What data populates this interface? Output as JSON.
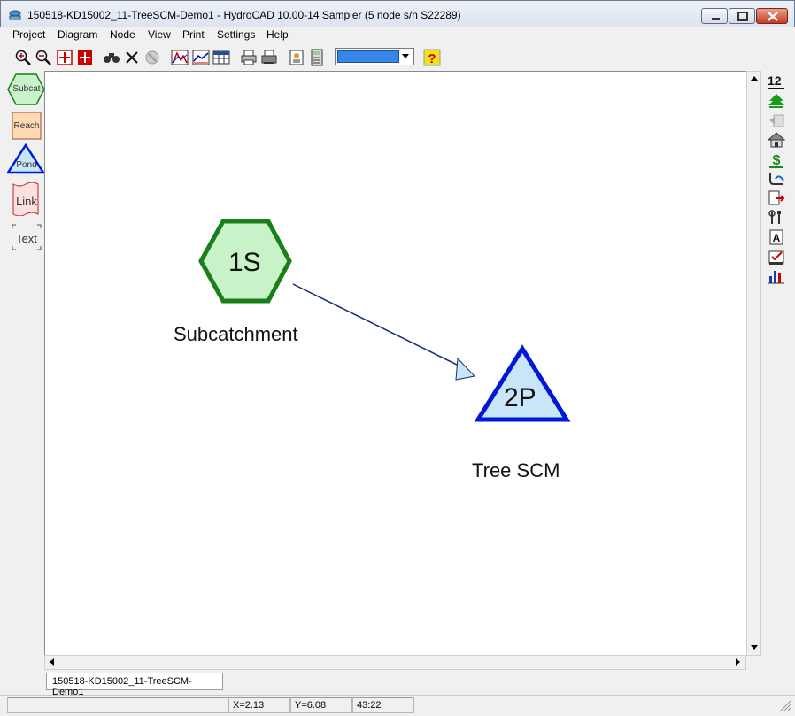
{
  "window": {
    "title": "150518-KD15002_11-TreeSCM-Demo1 - HydroCAD 10.00-14 Sampler (5 node s/n S22289)"
  },
  "menu": [
    "Project",
    "Diagram",
    "Node",
    "View",
    "Print",
    "Settings",
    "Help"
  ],
  "toolbar": {
    "icons": [
      "zoom-in-icon",
      "zoom-out-icon",
      "zoom-fit-icon",
      "zoom-all-icon",
      "find-binoculars-icon",
      "delete-icon",
      "disabled-tool-icon",
      "hydrograph-icon",
      "chart-icon",
      "table-icon",
      "print-icon",
      "print-preview-icon",
      "report-icon",
      "calculator-icon",
      "help-icon"
    ],
    "color_value": "#3a86e8"
  },
  "palette": {
    "subcat": "Subcat",
    "reach": "Reach",
    "pond": "Pond",
    "link": "Link",
    "text": "Text"
  },
  "diagram": {
    "nodes": [
      {
        "id": "1S",
        "label": "Subcatchment",
        "type": "subcatchment"
      },
      {
        "id": "2P",
        "label": "Tree SCM",
        "type": "pond"
      }
    ],
    "link": {
      "from": "1S",
      "to": "2P"
    }
  },
  "right_tools": {
    "top_label": "12",
    "icons": [
      "numbering-icon",
      "tree-icon",
      "back-disabled-icon",
      "house-icon",
      "dollar-icon",
      "pipe-icon",
      "export-icon",
      "tools-icon",
      "text-box-icon",
      "checklist-icon",
      "bar-chart-icon"
    ]
  },
  "tabs": {
    "document": "150518-KD15002_11-TreeSCM-Demo1"
  },
  "status": {
    "x": "X=2.13",
    "y": "Y=6.08",
    "time": "43:22"
  },
  "colors": {
    "subcat_fill": "#c8f2c8",
    "subcat_stroke": "#1a7f1a",
    "pond_fill": "#c8e6f8",
    "pond_stroke": "#0018d8",
    "link_stroke": "#1a2a7a"
  }
}
